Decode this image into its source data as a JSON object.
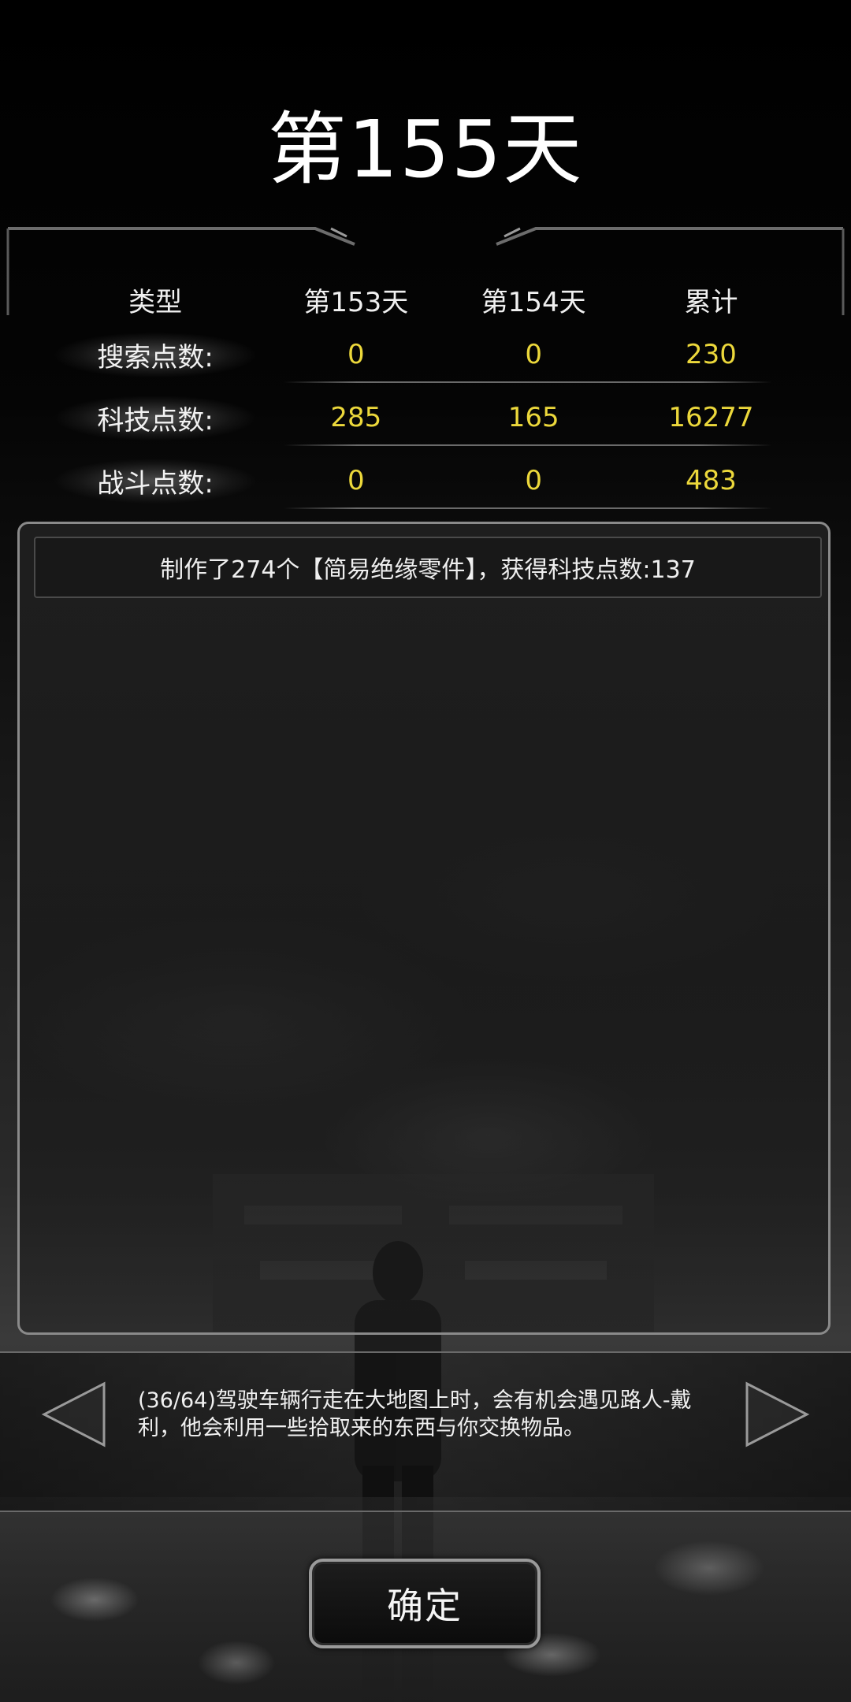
{
  "title": "第155天",
  "stats": {
    "headers": [
      "类型",
      "第153天",
      "第154天",
      "累计"
    ],
    "rows": [
      {
        "label": "搜索点数:",
        "values": [
          "0",
          "0",
          "230"
        ]
      },
      {
        "label": "科技点数:",
        "values": [
          "285",
          "165",
          "16277"
        ]
      },
      {
        "label": "战斗点数:",
        "values": [
          "0",
          "0",
          "483"
        ]
      }
    ]
  },
  "log": {
    "entries": [
      "制作了274个【简易绝缘零件】，获得科技点数:137"
    ]
  },
  "tip": {
    "text": "(36/64)驾驶车辆行走在大地图上时，会有机会遇见路人-戴利，他会利用一些拾取来的东西与你交换物品。"
  },
  "buttons": {
    "confirm": "确定"
  },
  "icons": {
    "prev": "triangle-left-icon",
    "next": "triangle-right-icon"
  },
  "colors": {
    "value_text": "#ecd83b",
    "background": "#000000",
    "frame": "#8a8a8a"
  }
}
